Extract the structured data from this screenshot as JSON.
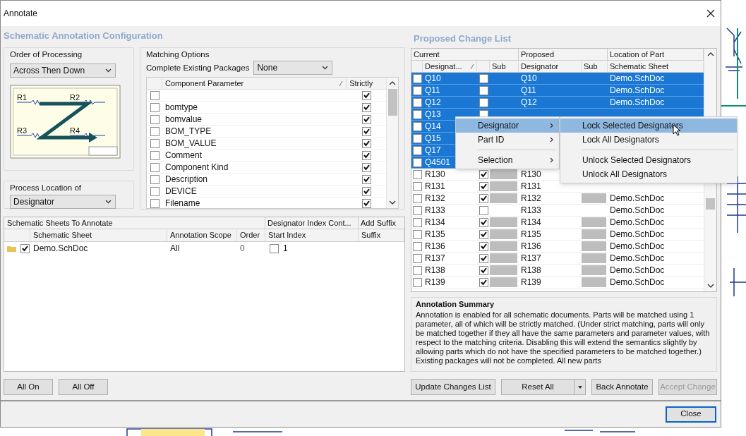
{
  "window": {
    "title": "Annotate"
  },
  "config": {
    "heading": "Schematic Annotation Configuration",
    "order_of_processing": {
      "label": "Order of Processing",
      "value": "Across Then Down",
      "diagram_labels": [
        "R1",
        "R2",
        "R3",
        "R4"
      ]
    },
    "process_location": {
      "label": "Process Location of",
      "value": "Designator"
    },
    "matching": {
      "label": "Matching Options",
      "complete_label": "Complete Existing Packages",
      "complete_value": "None",
      "columns": [
        "Component Parameter",
        "Strictly"
      ],
      "rows": [
        {
          "name": "",
          "checked": false,
          "strictly": true
        },
        {
          "name": "bomtype",
          "checked": false,
          "strictly": true
        },
        {
          "name": "bomvalue",
          "checked": false,
          "strictly": true
        },
        {
          "name": "BOM_TYPE",
          "checked": false,
          "strictly": true
        },
        {
          "name": "BOM_VALUE",
          "checked": false,
          "strictly": true
        },
        {
          "name": "Comment",
          "checked": false,
          "strictly": true
        },
        {
          "name": "Component Kind",
          "checked": false,
          "strictly": true
        },
        {
          "name": "Description",
          "checked": false,
          "strictly": true
        },
        {
          "name": "DEVICE",
          "checked": false,
          "strictly": true
        },
        {
          "name": "Filename",
          "checked": false,
          "strictly": true
        }
      ]
    }
  },
  "sheets": {
    "title": "Schematic Sheets To Annotate",
    "group_headers": [
      "Designator Index Cont...",
      "Add Suffix"
    ],
    "columns": [
      "Schematic Sheet",
      "Annotation Scope",
      "Order",
      "Start Index",
      "Suffix"
    ],
    "rows": [
      {
        "checked": true,
        "sheet": "Demo.SchDoc",
        "scope": "All",
        "order": "0",
        "index_checked": false,
        "start_index": "1"
      }
    ]
  },
  "left_buttons": [
    "All On",
    "All Off"
  ],
  "changes": {
    "title": "Proposed Change List",
    "group_headers": [
      "Current",
      "Proposed",
      "Location of Part"
    ],
    "columns": [
      "Designat...",
      "Sub",
      "Designator",
      "Sub",
      "Schematic Sheet"
    ],
    "rows": [
      {
        "current": "Q10",
        "checked": false,
        "lock": false,
        "proposed": "Q10",
        "location": "Demo.SchDoc",
        "selected": true
      },
      {
        "current": "Q11",
        "checked": false,
        "lock": false,
        "proposed": "Q11",
        "location": "Demo.SchDoc",
        "selected": true
      },
      {
        "current": "Q12",
        "checked": false,
        "lock": false,
        "proposed": "Q12",
        "location": "Demo.SchDoc",
        "selected": true
      },
      {
        "current": "Q13",
        "checked": false,
        "lock": false,
        "selected": true
      },
      {
        "current": "Q14",
        "checked": false,
        "selected": true
      },
      {
        "current": "Q15",
        "checked": false,
        "selected": true
      },
      {
        "current": "Q17",
        "checked": false,
        "selected": true
      },
      {
        "current": "Q4501",
        "checked": false,
        "selected": true
      },
      {
        "current": "R130",
        "checked": false,
        "lock": true,
        "proposed": "R130",
        "selected": false
      },
      {
        "current": "R131",
        "checked": false,
        "lock": true,
        "proposed": "R131",
        "selected": false
      },
      {
        "current": "R132",
        "checked": false,
        "lock": true,
        "proposed": "R132",
        "location": "Demo.SchDoc",
        "selected": false
      },
      {
        "current": "R133",
        "checked": false,
        "lock": false,
        "proposed": "R133",
        "location": "Demo.SchDoc",
        "selected": false
      },
      {
        "current": "R134",
        "checked": false,
        "lock": true,
        "proposed": "R134",
        "location": "Demo.SchDoc",
        "selected": false
      },
      {
        "current": "R135",
        "checked": false,
        "lock": true,
        "proposed": "R135",
        "location": "Demo.SchDoc",
        "selected": false
      },
      {
        "current": "R136",
        "checked": false,
        "lock": true,
        "proposed": "R136",
        "location": "Demo.SchDoc",
        "selected": false
      },
      {
        "current": "R137",
        "checked": false,
        "lock": true,
        "proposed": "R137",
        "location": "Demo.SchDoc",
        "selected": false
      },
      {
        "current": "R138",
        "checked": false,
        "lock": true,
        "proposed": "R138",
        "location": "Demo.SchDoc",
        "selected": false
      },
      {
        "current": "R139",
        "checked": false,
        "lock": true,
        "proposed": "R139",
        "location": "Demo.SchDoc",
        "selected": false
      }
    ]
  },
  "summary": {
    "title": "Annotation Summary",
    "text": "Annotation is enabled for all schematic documents. Parts will be matched using 1 parameter, all of which will be strictly matched. (Under strict matching, parts will only be matched together if they all have the same parameters and parameter values, with respect to the matching criteria. Disabling this will extend the semantics slightly by allowing parts which do not have the specified parameters to be matched together.) Existing packages will not be completed. All new parts"
  },
  "right_buttons": [
    {
      "label": "Update Changes List",
      "kind": "plain",
      "disabled": false
    },
    {
      "label": "Reset All",
      "kind": "split",
      "disabled": false
    },
    {
      "label": "Back Annotate",
      "kind": "plain",
      "disabled": false
    },
    {
      "label": "Accept Change",
      "kind": "plain",
      "disabled": true
    }
  ],
  "close_button": "Close",
  "context_menu": {
    "items": [
      {
        "label": "Designator",
        "selected": true,
        "separator_before": false
      },
      {
        "label": "Part ID",
        "selected": false,
        "separator_before": false
      },
      {
        "label": "Selection",
        "selected": false,
        "separator_before": true
      }
    ],
    "submenu": [
      {
        "label": "Lock Selected Designators",
        "selected": true,
        "separator_before": false
      },
      {
        "label": "Lock All Designators",
        "selected": false,
        "separator_before": false
      },
      {
        "label": "Unlock Selected Designators",
        "selected": false,
        "separator_before": true
      },
      {
        "label": "Unlock All Designators",
        "selected": false,
        "separator_before": false
      }
    ]
  }
}
